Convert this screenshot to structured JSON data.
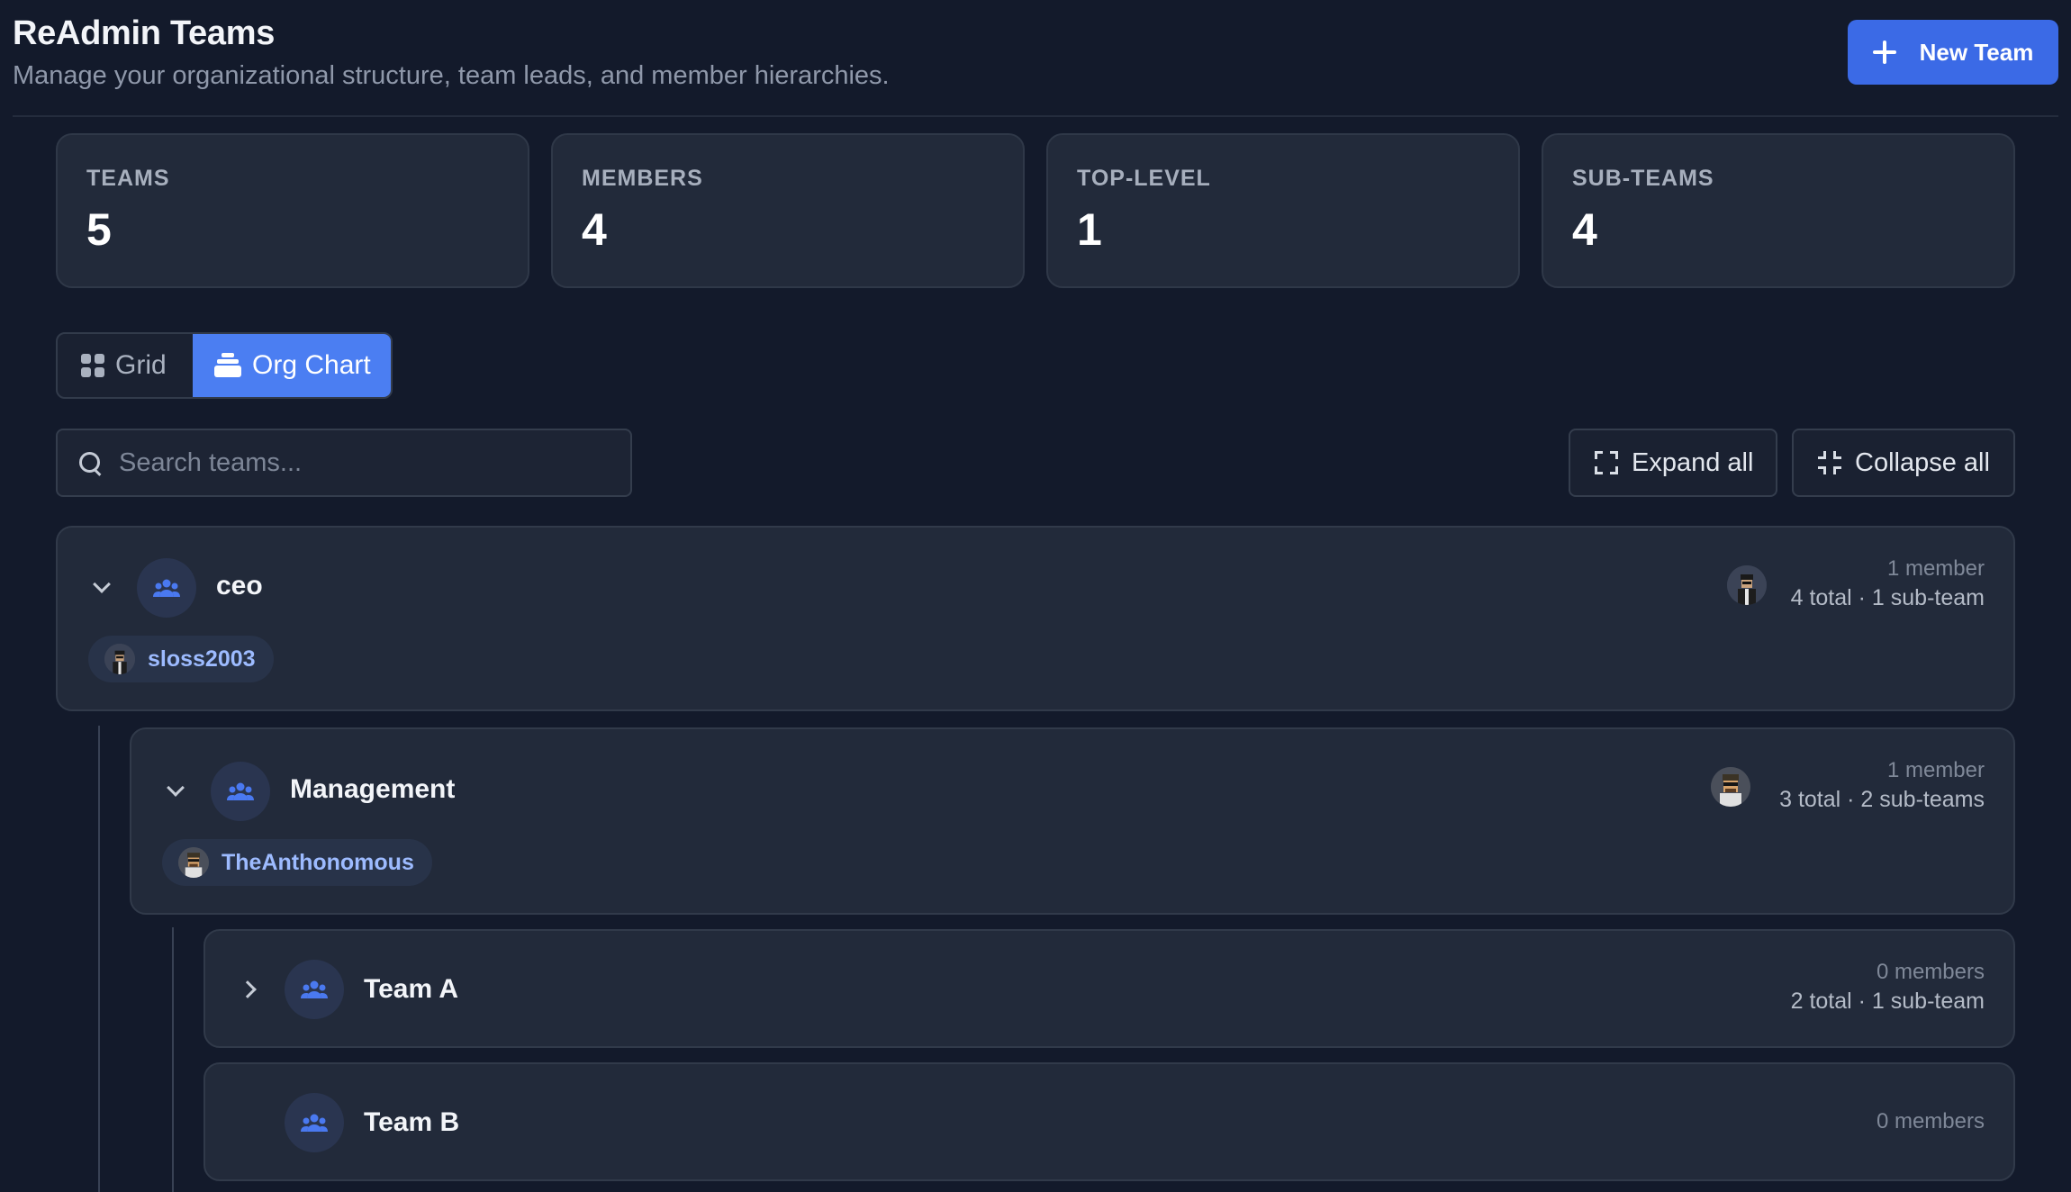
{
  "header": {
    "title": "ReAdmin Teams",
    "subtitle": "Manage your organizational structure, team leads, and member hierarchies.",
    "new_team_label": "New Team"
  },
  "stats": [
    {
      "label": "TEAMS",
      "value": "5"
    },
    {
      "label": "MEMBERS",
      "value": "4"
    },
    {
      "label": "TOP-LEVEL",
      "value": "1"
    },
    {
      "label": "SUB-TEAMS",
      "value": "4"
    }
  ],
  "view_toggle": {
    "grid_label": "Grid",
    "org_label": "Org Chart",
    "active": "Org Chart"
  },
  "search": {
    "placeholder": "Search teams..."
  },
  "actions": {
    "expand_label": "Expand all",
    "collapse_label": "Collapse all"
  },
  "colors": {
    "accent": "#3b6ae6",
    "background": "#131a2b",
    "card": "#222a3a",
    "chip_text": "#9dbbff"
  },
  "tree": [
    {
      "name": "ceo",
      "member_count": "1 member",
      "summary": "4 total · 1 sub-team",
      "members": [
        "sloss2003"
      ],
      "expanded": true
    },
    {
      "name": "Management",
      "member_count": "1 member",
      "summary": "3 total · 2 sub-teams",
      "members": [
        "TheAnthonomous"
      ],
      "expanded": true
    },
    {
      "name": "Team A",
      "member_count": "0 members",
      "summary": "2 total · 1 sub-team",
      "expanded": false
    },
    {
      "name": "Team B",
      "member_count": "0 members",
      "summary": ""
    }
  ]
}
